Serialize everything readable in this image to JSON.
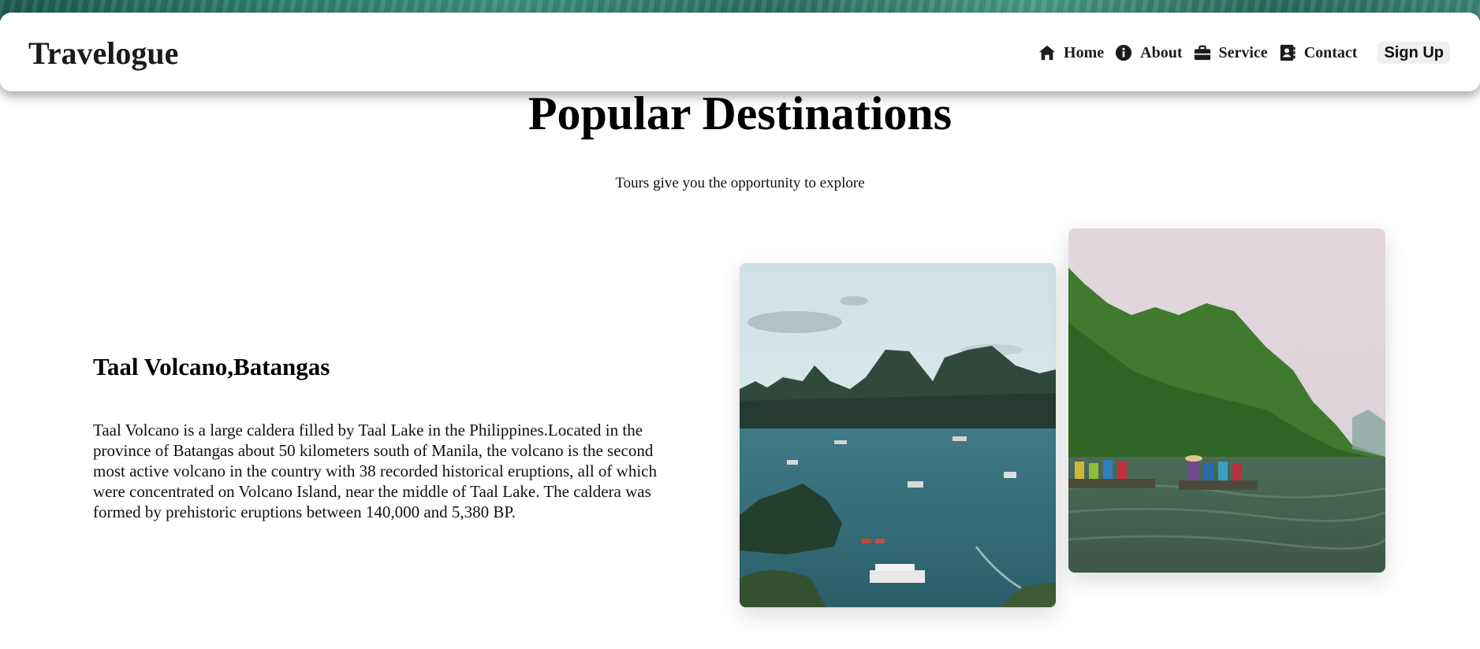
{
  "app": {
    "brand": "Travelogue"
  },
  "nav": {
    "items": [
      {
        "label": "Home",
        "icon": "home-icon"
      },
      {
        "label": "About",
        "icon": "info-icon"
      },
      {
        "label": "Service",
        "icon": "briefcase-icon"
      },
      {
        "label": "Contact",
        "icon": "contact-book-icon"
      }
    ],
    "signup_label": "Sign Up"
  },
  "hero": {
    "title": "Popular Destinations",
    "subtitle": "Tours give you the opportunity to explore"
  },
  "destination": {
    "name": "Taal Volcano,Batangas",
    "description": "Taal Volcano is a large caldera filled by Taal Lake in the Philippines.Located in the province of Batangas about 50 kilometers south of Manila, the volcano is the second most active volcano in the country with 38 recorded historical eruptions, all of which were concentrated on Volcano Island, near the middle of Taal Lake. The caldera was formed by prehistoric eruptions between 140,000 and 5,380 BP."
  },
  "colors": {
    "nav_bg": "#ffffff",
    "signup_bg": "#efefef",
    "text": "#111111",
    "header_strip": "#2f7d6f"
  }
}
